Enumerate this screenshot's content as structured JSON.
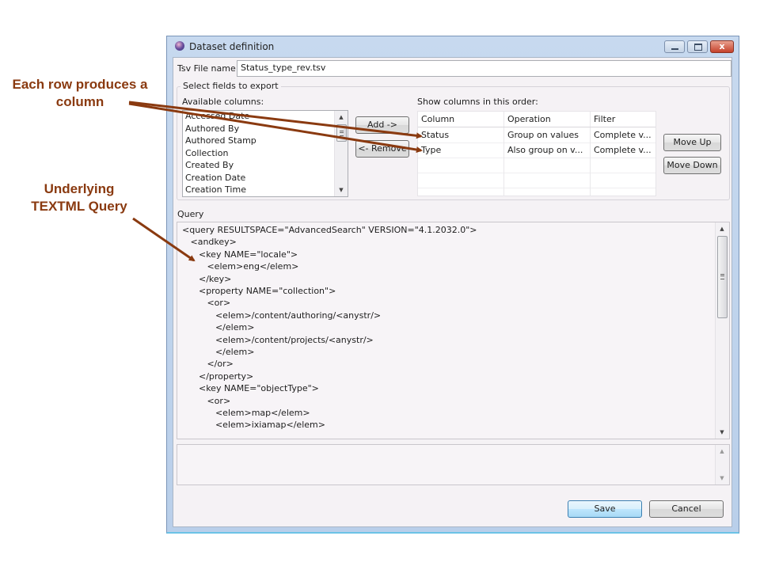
{
  "annotations": {
    "row_columns": "Each row produces a column",
    "textml_query": "Underlying TEXTML Query",
    "color": "#8a3a10"
  },
  "window": {
    "title": "Dataset definition",
    "icon": "app-globe-icon",
    "controls": {
      "minimize": "minimize-icon",
      "maximize": "maximize-icon",
      "close": "x"
    }
  },
  "tsv": {
    "label": "Tsv File name",
    "value": "Status_type_rev.tsv"
  },
  "fields": {
    "group_label": "Select fields to export",
    "available_label": "Available columns:",
    "available_columns": [
      "Accessed Date",
      "Authored By",
      "Authored Stamp",
      "Collection",
      "Created By",
      "Creation Date",
      "Creation Time"
    ],
    "add_label": "Add ->",
    "remove_label": "<- Remove",
    "order_label": "Show columns in this order:",
    "table": {
      "headers": [
        "Column",
        "Operation",
        "Filter"
      ],
      "rows": [
        [
          "Status",
          "Group on values",
          "Complete v..."
        ],
        [
          "Type",
          "Also group on v...",
          "Complete v..."
        ]
      ]
    },
    "move_up_label": "Move Up",
    "move_down_label": "Move Down"
  },
  "query": {
    "label": "Query",
    "lines": [
      "<query RESULTSPACE=\"AdvancedSearch\" VERSION=\"4.1.2032.0\">",
      "   <andkey>",
      "      <key NAME=\"locale\">",
      "         <elem>eng</elem>",
      "      </key>",
      "      <property NAME=\"collection\">",
      "         <or>",
      "            <elem>/content/authoring/<anystr/>",
      "            </elem>",
      "            <elem>/content/projects/<anystr/>",
      "            </elem>",
      "         </or>",
      "      </property>",
      "      <key NAME=\"objectType\">",
      "         <or>",
      "            <elem>map</elem>",
      "            <elem>ixiamap</elem>"
    ]
  },
  "footer": {
    "save_label": "Save",
    "cancel_label": "Cancel"
  }
}
